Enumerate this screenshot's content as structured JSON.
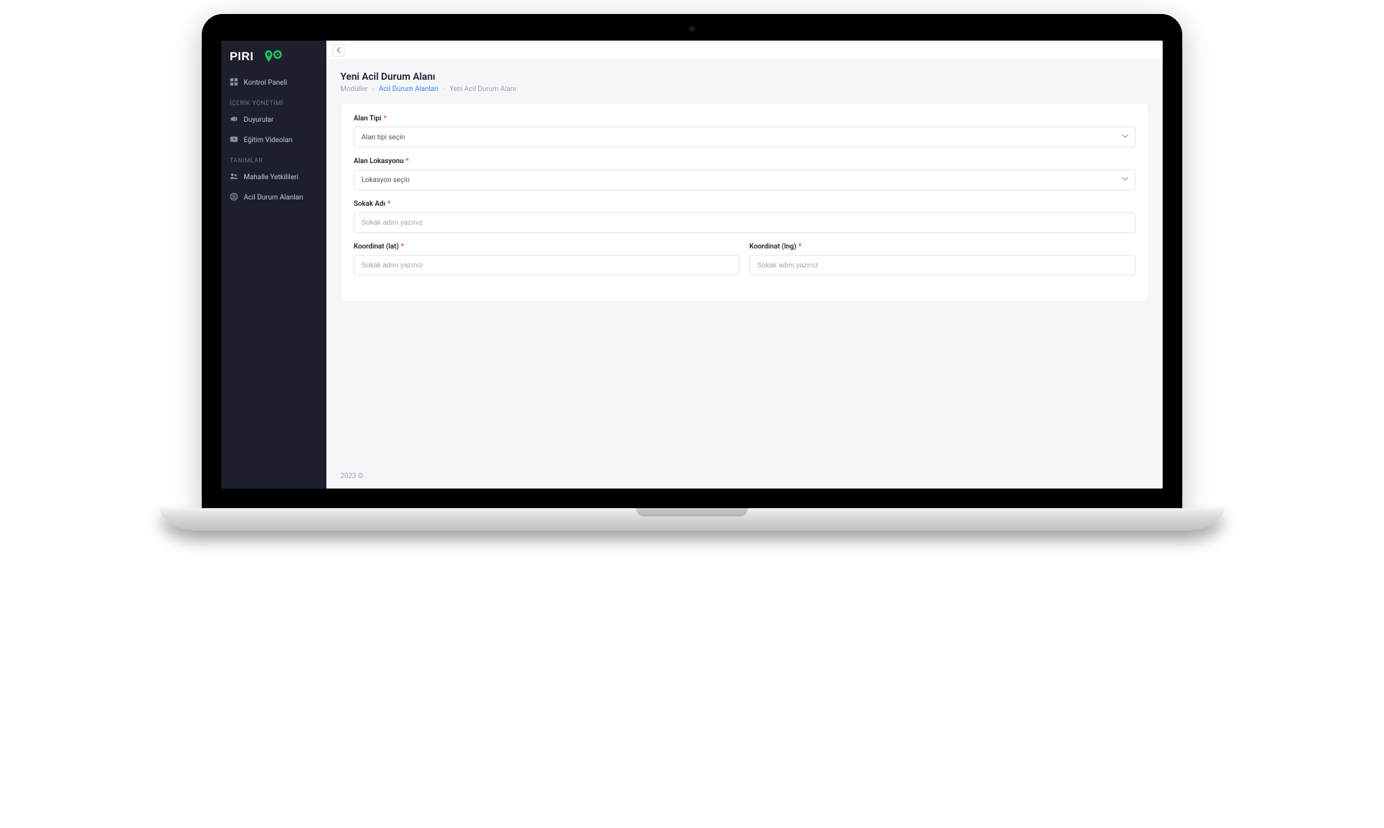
{
  "brand": {
    "name": "PIRIGO"
  },
  "sidebar": {
    "items": [
      {
        "label": "Kontrol Paneli",
        "icon": "dashboard-icon"
      }
    ],
    "sections": [
      {
        "title": "İÇERİK YÖNETİMİ",
        "items": [
          {
            "label": "Duyurular",
            "icon": "megaphone-icon"
          },
          {
            "label": "Eğitim Videoları",
            "icon": "video-icon"
          }
        ]
      },
      {
        "title": "TANIMLAR",
        "items": [
          {
            "label": "Mahalle Yetkilileri",
            "icon": "users-icon"
          },
          {
            "label": "Acil Durum Alanları",
            "icon": "globe-icon"
          }
        ]
      }
    ]
  },
  "page": {
    "title": "Yeni Acil Durum Alanı",
    "breadcrumb": {
      "root": "Modüller",
      "link": "Acil Durum Alanları",
      "current": "Yeni Acil Durum Alanı"
    }
  },
  "form": {
    "alanTipi": {
      "label": "Alan Tipi",
      "placeholder": "Alan tipi seçin",
      "value": ""
    },
    "alanLokasyonu": {
      "label": "Alan Lokasyonu",
      "placeholder": "Lokasyon seçin",
      "value": ""
    },
    "sokakAdi": {
      "label": "Sokak Adı",
      "placeholder": "Sokak adını yazınız",
      "value": ""
    },
    "lat": {
      "label": "Koordinat (lat)",
      "placeholder": "Sokak adını yazınız",
      "value": ""
    },
    "lng": {
      "label": "Koordinat (lng)",
      "placeholder": "Sokak adını yazınız",
      "value": ""
    }
  },
  "footer": {
    "text": "2023 ©"
  }
}
